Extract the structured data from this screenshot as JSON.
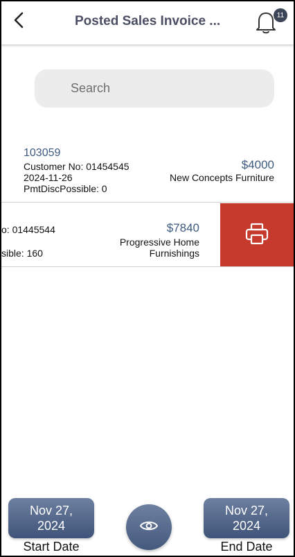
{
  "header": {
    "title": "Posted Sales Invoice ...",
    "notification_count": "11"
  },
  "search": {
    "placeholder": "Search",
    "value": ""
  },
  "invoices": [
    {
      "number": "103059",
      "customer_no": "Customer No: 01454545",
      "date": "2024-11-26",
      "pmt_disc": "PmtDiscPossible: 0",
      "amount": "$4000",
      "customer_name": "New Concepts Furniture"
    },
    {
      "customer_no_partial": "o: 01445544",
      "pmt_disc_partial": "sible: 160",
      "amount": "$7840",
      "customer_name_line1": "Progressive Home",
      "customer_name_line2": "Furnishings"
    }
  ],
  "bottom": {
    "start_date_line1": "Nov 27,",
    "start_date_line2": "2024",
    "start_label": "Start Date",
    "end_date_line1": "Nov 27,",
    "end_date_line2": "2024",
    "end_label": "End Date"
  },
  "colors": {
    "accent": "#3d5a80",
    "print_action": "#c63a2e",
    "button_gradient_top": "#6e80a0",
    "button_gradient_bottom": "#3f5479"
  },
  "icons": {
    "back": "chevron-left-icon",
    "notifications": "bell-icon",
    "print": "printer-icon",
    "view": "eye-icon"
  }
}
